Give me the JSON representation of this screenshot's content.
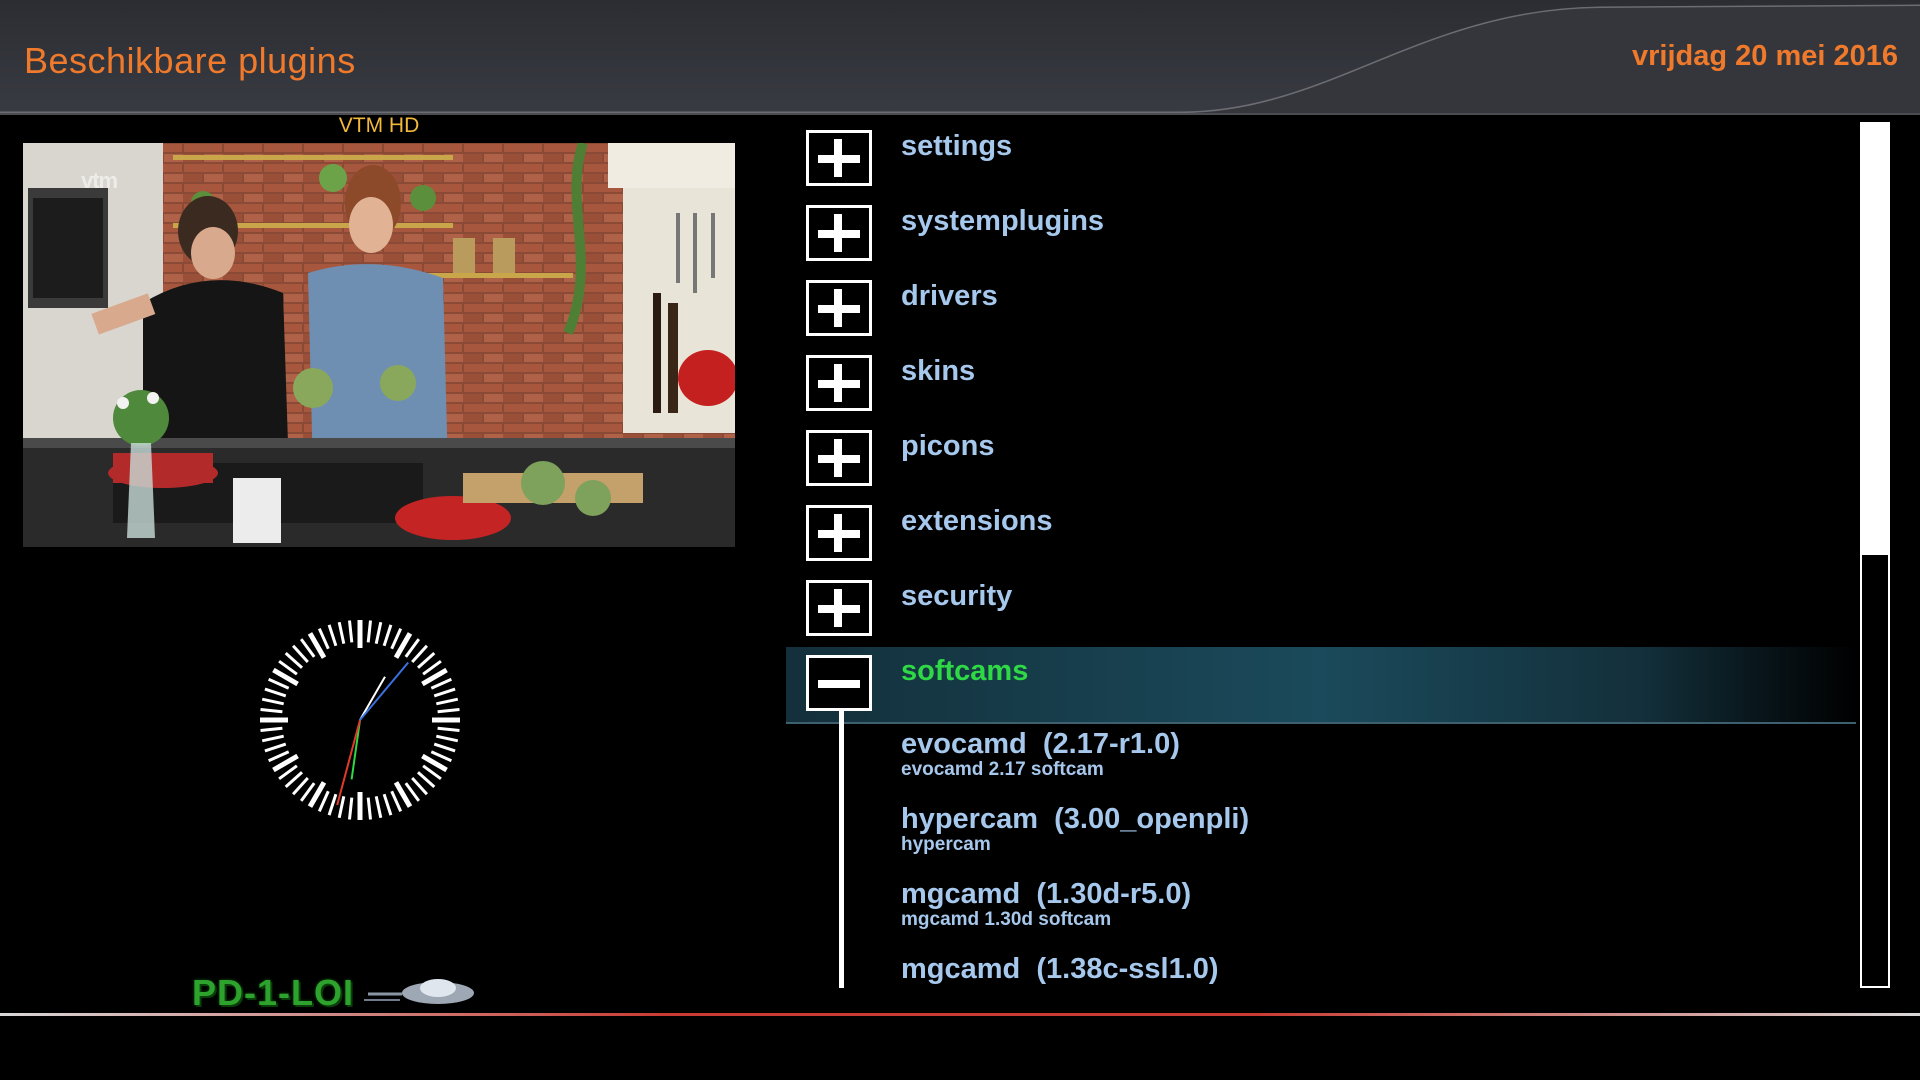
{
  "header": {
    "title": "Beschikbare plugins",
    "date": "vrijdag 20 mei 2016"
  },
  "preview": {
    "channel": "VTM HD",
    "channel_logo": "vtm"
  },
  "brand": {
    "text": "PD-1-LOI"
  },
  "categories": [
    {
      "label": "settings",
      "state": "collapsed"
    },
    {
      "label": "systemplugins",
      "state": "collapsed"
    },
    {
      "label": "drivers",
      "state": "collapsed"
    },
    {
      "label": "skins",
      "state": "collapsed"
    },
    {
      "label": "picons",
      "state": "collapsed"
    },
    {
      "label": "extensions",
      "state": "collapsed"
    },
    {
      "label": "security",
      "state": "collapsed"
    },
    {
      "label": "softcams",
      "state": "expanded",
      "selected": true
    }
  ],
  "softcams": [
    {
      "name": "evocamd  (2.17-r1.0)",
      "description": "evocamd 2.17 softcam"
    },
    {
      "name": "hypercam  (3.00_openpli)",
      "description": "hypercam"
    },
    {
      "name": "mgcamd  (1.30d-r5.0)",
      "description": "mgcamd 1.30d softcam"
    },
    {
      "name": "mgcamd  (1.38c-ssl1.0)",
      "description": ""
    }
  ],
  "scrollbar": {
    "position_fraction": 0.5
  },
  "icons": {
    "collapsed": "plus-box-icon",
    "expanded": "minus-box-icon"
  },
  "colors": {
    "title": "#f07a2c",
    "item_text": "#a6c8ec",
    "selected_text": "#2fd845",
    "channel_name": "#f2b93a"
  }
}
